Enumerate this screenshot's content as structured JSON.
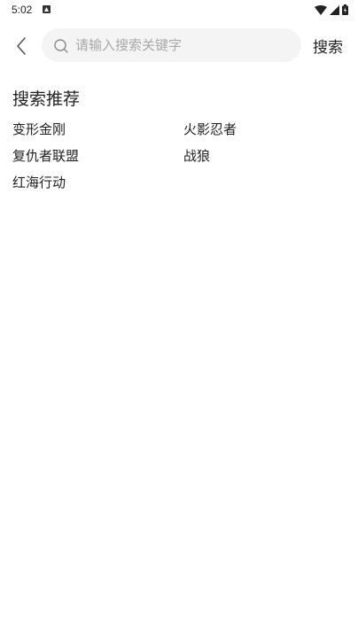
{
  "status_bar": {
    "time": "5:02"
  },
  "header": {
    "back_icon": "chevron-left-icon",
    "search": {
      "placeholder": "请输入搜索关键字",
      "value": "",
      "icon": "search-icon"
    },
    "search_button_label": "搜索"
  },
  "recommend": {
    "title": "搜索推荐",
    "items": [
      {
        "label": "变形金刚"
      },
      {
        "label": "火影忍者"
      },
      {
        "label": "复仇者联盟"
      },
      {
        "label": "战狼"
      },
      {
        "label": "红海行动"
      }
    ]
  }
}
